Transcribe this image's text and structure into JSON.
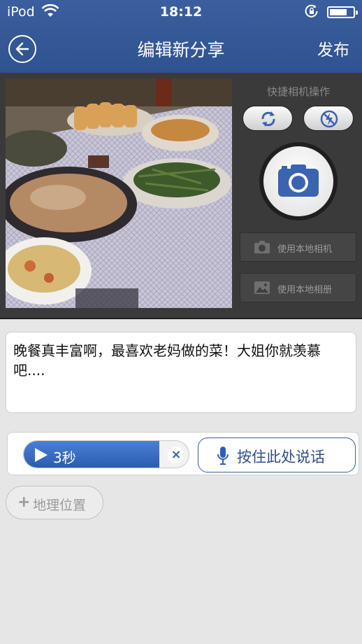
{
  "status_bar": {
    "carrier": "iPod",
    "time": "18:12"
  },
  "nav": {
    "title": "编辑新分享",
    "publish_label": "发布"
  },
  "camera_panel": {
    "quick_label": "快捷相机操作",
    "local_camera_label": "使用本地相机",
    "local_album_label": "使用本地相册"
  },
  "post": {
    "text": "晚餐真丰富啊，最喜欢老妈做的菜！大姐你就羡慕吧...."
  },
  "voice": {
    "duration": "3秒",
    "talk_label": "按住此处说话"
  },
  "location": {
    "label": "地理位置"
  },
  "colors": {
    "header_blue": "#2f5290",
    "accent_blue": "#3a63b0",
    "panel_dark": "#3a3a3a",
    "page_bg": "#e6e6e6"
  }
}
